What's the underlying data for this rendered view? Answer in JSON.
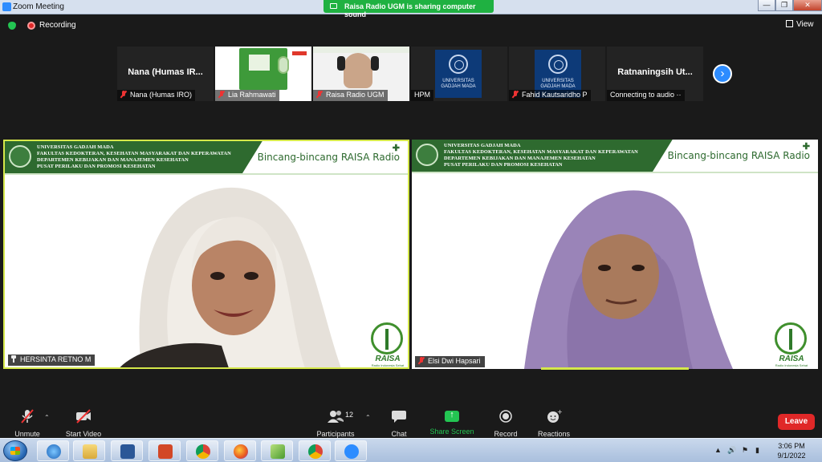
{
  "window": {
    "title": "Zoom Meeting",
    "controls": [
      "—",
      "❐",
      "✕"
    ]
  },
  "share_banner": "Raisa Radio UGM is sharing computer sound",
  "status": {
    "recording": "Recording",
    "view": "View"
  },
  "thumbnails": [
    {
      "big_name": "Nana (Humas IR...",
      "caption": "Nana (Humas IRO)",
      "muted": true,
      "type": "name"
    },
    {
      "caption": "Lia Rahmawati",
      "muted": true,
      "type": "slide"
    },
    {
      "caption": "Raisa Radio UGM",
      "muted": true,
      "type": "woman"
    },
    {
      "caption": "HPM",
      "muted": false,
      "type": "ugm",
      "logo_text": "UNIVERSITAS GADJAH MADA"
    },
    {
      "caption": "Fahid Kautsaridho P",
      "muted": true,
      "type": "ugm",
      "logo_text": "UNIVERSITAS GADJAH MADA"
    },
    {
      "big_name": "Ratnaningsih  Ut...",
      "caption": "Connecting to audio ··",
      "muted": false,
      "type": "name"
    }
  ],
  "videos": [
    {
      "institution": [
        "UNIVERSITAS GADJAH MADA",
        "FAKULTAS KEDOKTERAN, KESEHATAN MASYARAKAT DAN KEPERAWATAN",
        "DEPARTEMEN KEBIJAKAN DAN MANAJEMEN KESEHATAN",
        "PUSAT PERILAKU DAN PROMOSI KESEHATAN"
      ],
      "program": "Bincang-bincang RAISA Radio",
      "logo_word": "RAISA",
      "logo_sub": "Radio Indonesia Sehat",
      "name": "HERSINTA RETNO M",
      "active": true
    },
    {
      "institution": [
        "UNIVERSITAS GADJAH MADA",
        "FAKULTAS KEDOKTERAN, KESEHATAN MASYARAKAT DAN KEPERAWATAN",
        "DEPARTEMEN KEBIJAKAN DAN MANAJEMEN KESEHATAN",
        "PUSAT PERILAKU DAN PROMOSI KESEHATAN"
      ],
      "program": "Bincang-bincang RAISA Radio",
      "logo_word": "RAISA",
      "logo_sub": "Radio Indonesia Sehat",
      "name": "Elsi Dwi Hapsari",
      "active": false
    }
  ],
  "controls": {
    "unmute": "Unmute",
    "start_video": "Start Video",
    "participants": "Participants",
    "participants_count": "12",
    "chat": "Chat",
    "share_screen": "Share Screen",
    "record": "Record",
    "reactions": "Reactions",
    "leave": "Leave"
  },
  "taskbar": {
    "apps": [
      "internet-explorer",
      "file-explorer",
      "word",
      "powerpoint",
      "chrome",
      "firefox",
      "app-green",
      "chrome-profile",
      "zoom"
    ],
    "time": "3:06 PM",
    "date": "9/1/2022"
  },
  "colors": {
    "zoom_blue": "#2d8cff",
    "share_green": "#23c552",
    "leave_red": "#e02828",
    "header_green": "#2e6a2f",
    "active_speaker": "#d5e84a"
  }
}
